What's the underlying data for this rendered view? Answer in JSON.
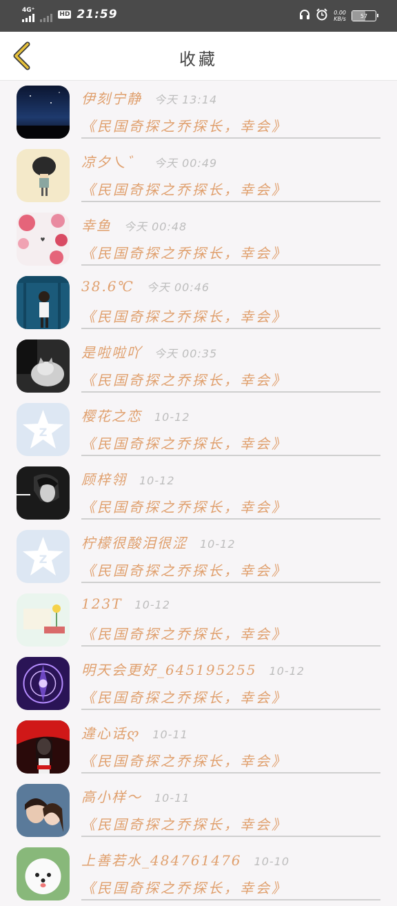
{
  "status_bar": {
    "network": "4G⁺",
    "hd": "HD",
    "time": "21:59",
    "speed_value": "0.00",
    "speed_unit": "KB/s",
    "battery": "57",
    "battery_level": 0.57
  },
  "header": {
    "title": "收藏",
    "back_icon": "chevron-left-icon"
  },
  "colors": {
    "accent": "#e0a06e",
    "time_gray": "#bdbdbd",
    "divider": "#cfcfcf",
    "back_icon": "#e8c23a"
  },
  "favorites": [
    {
      "name": "伊刻宁静",
      "time": "今天 13:14",
      "book": "《民国奇探之乔探长，幸会》",
      "avatar": "night-sky"
    },
    {
      "name": "凉夕乀゛",
      "time": "今天 00:49",
      "book": "《民国奇探之乔探长，幸会》",
      "avatar": "cartoon-boy"
    },
    {
      "name": "幸鱼",
      "time": "今天 00:48",
      "book": "《民国奇探之乔探长，幸会》",
      "avatar": "flowers"
    },
    {
      "name": "38.6℃",
      "time": "今天 00:46",
      "book": "《民国奇探之乔探长，幸会》",
      "avatar": "girl-blue"
    },
    {
      "name": "是啦啦吖",
      "time": "今天 00:35",
      "book": "《民国奇探之乔探长，幸会》",
      "avatar": "cat"
    },
    {
      "name": "樱花之恋",
      "time": "10-12",
      "book": "《民国奇探之乔探长，幸会》",
      "avatar": "qzone-default"
    },
    {
      "name": "顾梓翎",
      "time": "10-12",
      "book": "《民国奇探之乔探长，幸会》",
      "avatar": "anime-dark"
    },
    {
      "name": "柠檬很酸泪很涩",
      "time": "10-12",
      "book": "《民国奇探之乔探长，幸会》",
      "avatar": "qzone-default"
    },
    {
      "name": "123T",
      "time": "10-12",
      "book": "《民国奇探之乔探长，幸会》",
      "avatar": "pastel-art"
    },
    {
      "name": "明天会更好_645195255",
      "time": "10-12",
      "book": "《民国奇探之乔探长，幸会》",
      "avatar": "purple-magic"
    },
    {
      "name": "違心话ღ",
      "time": "10-11",
      "book": "《民国奇探之乔探长，幸会》",
      "avatar": "anime-red"
    },
    {
      "name": "高小样～",
      "time": "10-11",
      "book": "《民国奇探之乔探长，幸会》",
      "avatar": "couple"
    },
    {
      "name": "上善若水_484761476",
      "time": "10-10",
      "book": "《民国奇探之乔探长，幸会》",
      "avatar": "white-dog"
    }
  ]
}
